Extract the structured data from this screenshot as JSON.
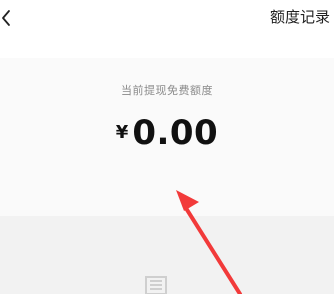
{
  "header": {
    "back_icon": "chevron-left-icon",
    "history_link_label": "额度记录"
  },
  "quota": {
    "label": "当前提现免费额度",
    "currency_symbol": "¥",
    "amount": "0.00"
  },
  "annotation": {
    "arrow_icon": "red-arrow-icon",
    "arrow_color": "#f23a3a"
  },
  "empty_state": {
    "icon": "document-icon"
  },
  "colors": {
    "background": "#ffffff",
    "card_background": "#fafafa",
    "bottom_background": "#f2f2f2",
    "label_text": "#8a8a8a",
    "amount_text": "#111111"
  }
}
